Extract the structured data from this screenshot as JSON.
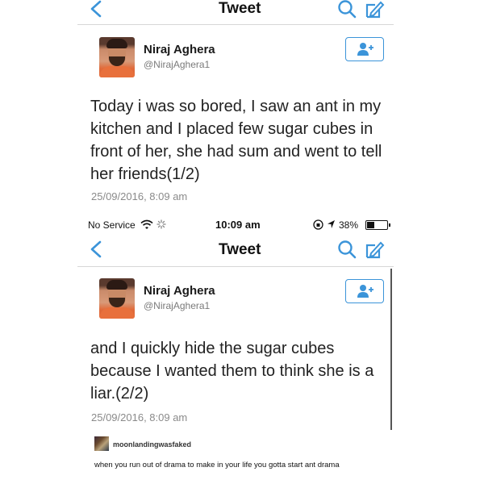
{
  "top_screen": {
    "nav": {
      "title": "Tweet"
    },
    "tweet": {
      "name": "Niraj Aghera",
      "handle": "@NirajAghera1",
      "text_lines": [
        "Today i was so bored, I saw an ant in my",
        "kitchen and I placed few sugar cubes in",
        "front of her, she had sum and went to tell",
        "her friends(1/2)"
      ],
      "timestamp": "25/09/2016, 8:09 am"
    }
  },
  "status_bar": {
    "carrier": "No Service",
    "time": "10:09 am",
    "battery_percent": "38%",
    "battery_level": 0.38
  },
  "bottom_screen": {
    "nav": {
      "title": "Tweet"
    },
    "tweet": {
      "name": "Niraj Aghera",
      "handle": "@NirajAghera1",
      "text_lines": [
        "and I quickly hide the sugar cubes",
        "because I wanted them to think she is a",
        "liar.(2/2)"
      ],
      "timestamp": "25/09/2016, 8:09 am"
    }
  },
  "tumblr": {
    "username": "moonlandingwasfaked",
    "caption": "when you run out of drama to make in your life you gotta start ant drama"
  },
  "icons": {
    "back": "chevron-left-icon",
    "search": "search-icon",
    "compose": "compose-icon",
    "follow": "follow-user-icon",
    "wifi": "wifi-icon",
    "location": "location-icon"
  },
  "colors": {
    "twitter_blue": "#3b94d9"
  }
}
